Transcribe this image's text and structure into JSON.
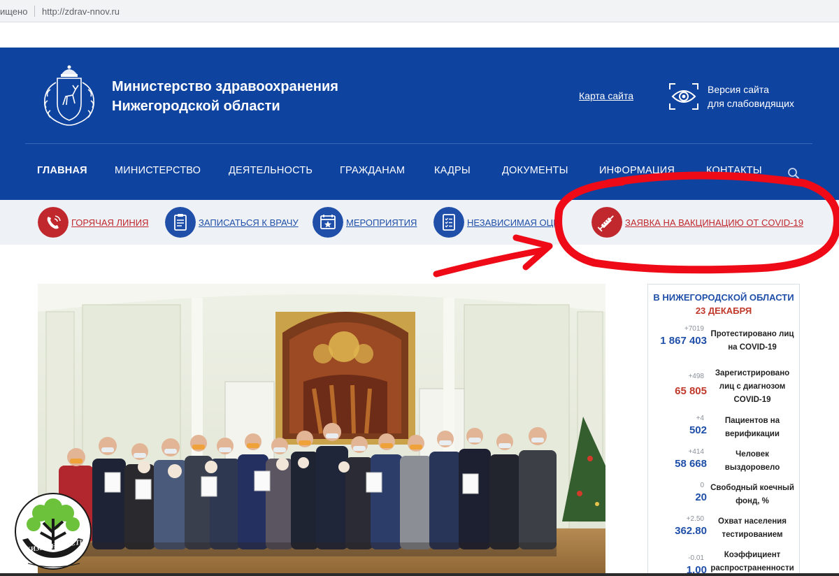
{
  "browser": {
    "security_text": "ищено",
    "url": "http://zdrav-nnov.ru"
  },
  "header": {
    "title_line1": "Министерство здравоохранения",
    "title_line2": "Нижегородской области",
    "sitemap_label": "Карта сайта",
    "vision_line1": "Версия сайта",
    "vision_line2": "для слабовидящих",
    "logo_icon": "coat-of-arms-icon",
    "vision_icon": "eye-icon",
    "search_icon": "search-icon"
  },
  "nav": {
    "items": [
      {
        "label": "ГЛАВНАЯ",
        "active": true
      },
      {
        "label": "МИНИСТЕРСТВО"
      },
      {
        "label": "ДЕЯТЕЛЬНОСТЬ"
      },
      {
        "label": "ГРАЖДАНАМ"
      },
      {
        "label": "КАДРЫ"
      },
      {
        "label": "ДОКУМЕНТЫ"
      },
      {
        "label": "ИНФОРМАЦИЯ"
      },
      {
        "label": "КОНТАКТЫ"
      }
    ]
  },
  "quick_links": [
    {
      "label": "ГОРЯЧАЯ ЛИНИЯ",
      "icon": "phone-icon",
      "color": "#c0282d"
    },
    {
      "label": "ЗАПИСАТЬСЯ К ВРАЧУ",
      "icon": "clipboard-icon",
      "color": "#1f4fa8"
    },
    {
      "label": "МЕРОПРИЯТИЯ",
      "icon": "calendar-star-icon",
      "color": "#1f4fa8"
    },
    {
      "label": "НЕЗАВИСИМАЯ ОЦЕ",
      "icon": "checklist-icon",
      "color": "#1f4fa8"
    },
    {
      "label": "ЗАЯВКА НА ВАКЦИНАЦИЮ ОТ COVID-19",
      "icon": "syringe-icon",
      "color": "#c0282d"
    }
  ],
  "stats": {
    "heading": "В НИЖЕГОРОДСКОЙ ОБЛАСТИ",
    "date": "23 ДЕКАБРЯ",
    "items": [
      {
        "delta": "+7019",
        "value": "1 867 403",
        "label": "Протестировано лиц на COVID-19",
        "color": "#1f4fa8"
      },
      {
        "delta": "+498",
        "value": "65 805",
        "label": "Зарегистрировано лиц с диагнозом COVID-19",
        "color": "#c0392b"
      },
      {
        "delta": "+4",
        "value": "502",
        "label": "Пациентов на верификации",
        "color": "#1f4fa8"
      },
      {
        "delta": "+414",
        "value": "58 668",
        "label": "Человек выздоровело",
        "color": "#1f4fa8"
      },
      {
        "delta": "0",
        "value": "20",
        "label": "Свободный коечный фонд, %",
        "color": "#1f4fa8"
      },
      {
        "delta": "+2.50",
        "value": "362.80",
        "label": "Охват населения тестированием",
        "color": "#1f4fa8"
      },
      {
        "delta": "-0.01",
        "value": "1.00",
        "label": "Коэффициент распространенности",
        "color": "#1f4fa8"
      }
    ]
  },
  "colors": {
    "header_blue": "#0f43a0",
    "accent_red": "#c0282d",
    "annotation_red": "#ee0a16"
  },
  "watermark": {
    "text": "ЖИЗНЬ НОВОСТИ",
    "icon": "tree-hands-logo-icon"
  }
}
